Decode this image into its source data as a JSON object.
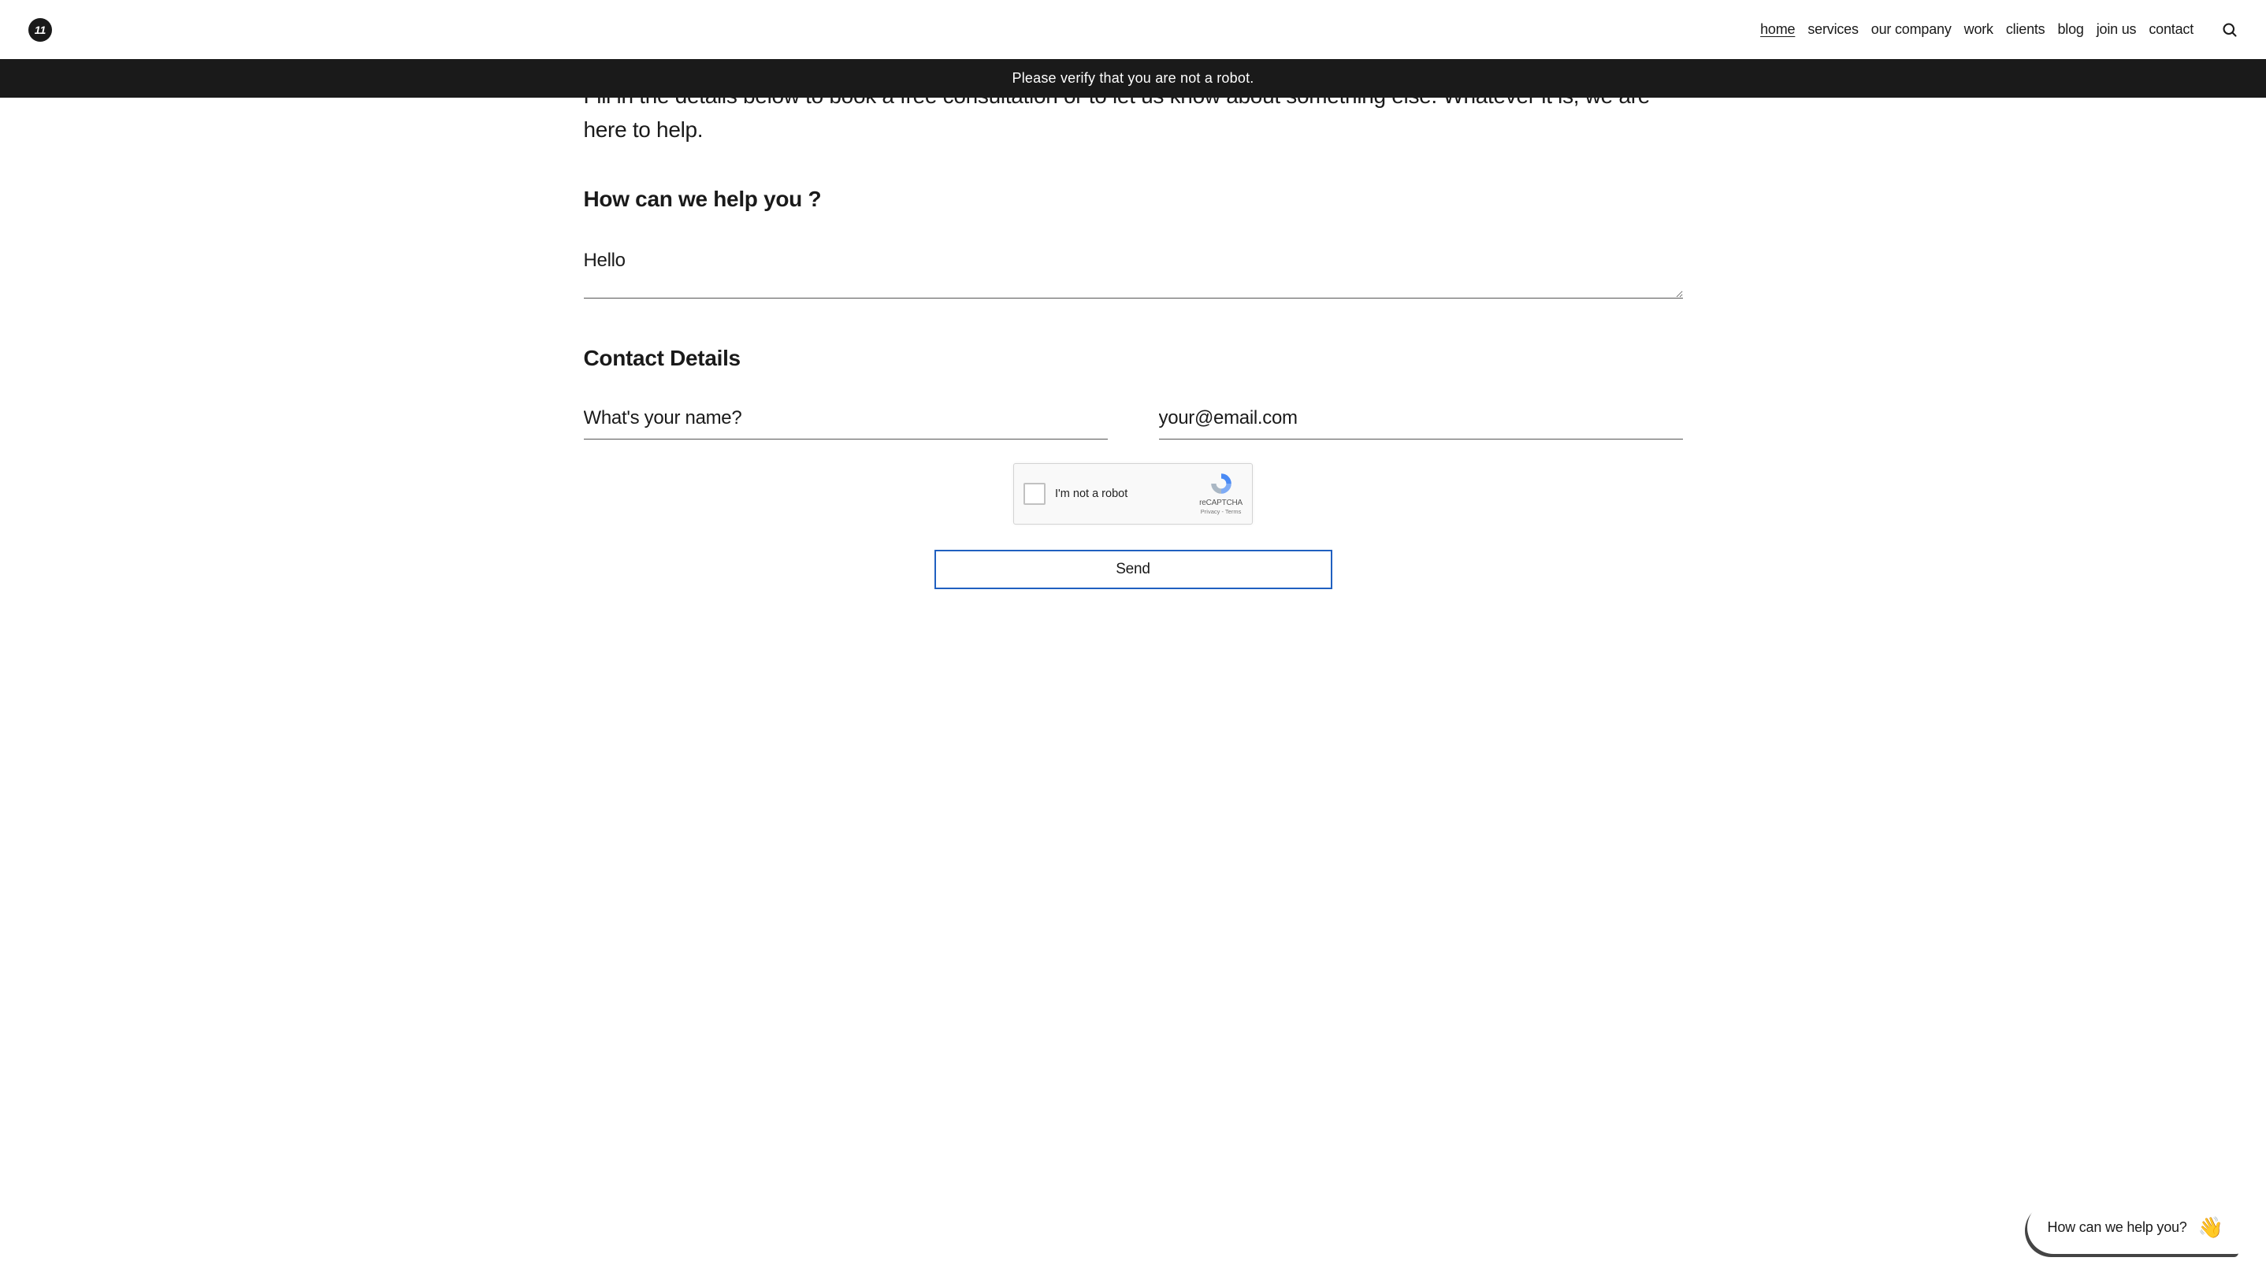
{
  "header": {
    "logo_text": "11",
    "nav": [
      {
        "label": "home",
        "active": true
      },
      {
        "label": "services",
        "active": false
      },
      {
        "label": "our company",
        "active": false
      },
      {
        "label": "work",
        "active": false
      },
      {
        "label": "clients",
        "active": false
      },
      {
        "label": "blog",
        "active": false
      },
      {
        "label": "join us",
        "active": false
      },
      {
        "label": "contact",
        "active": false
      }
    ]
  },
  "notification": {
    "message": "Please verify that you are not a robot."
  },
  "form": {
    "intro": "Fill in the details below to book a free consultation or to let us know about something else. Whatever it is, we are here to help.",
    "help_heading": "How can we help you ?",
    "message_placeholder": "Hello",
    "contact_heading": "Contact Details",
    "name_placeholder": "What's your name?",
    "email_placeholder": "your@email.com",
    "recaptcha": {
      "label": "I'm not a robot",
      "brand": "reCAPTCHA",
      "privacy": "Privacy",
      "terms": "Terms"
    },
    "submit_label": "Send"
  },
  "chat": {
    "prompt": "How can we help you?",
    "emoji": "👋"
  }
}
